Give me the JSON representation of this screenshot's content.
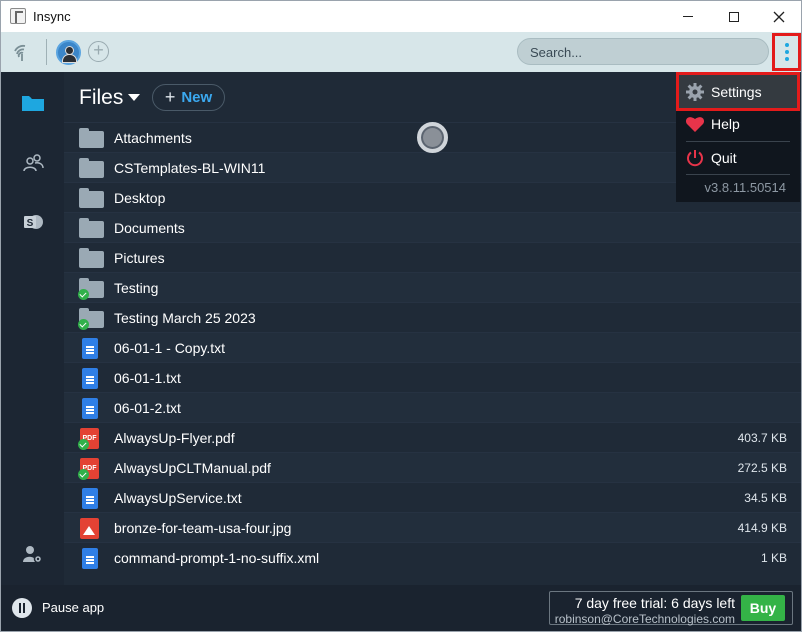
{
  "window": {
    "title": "Insync"
  },
  "toolbar": {
    "search_placeholder": "Search..."
  },
  "header": {
    "title": "Files",
    "new_label": "New"
  },
  "colors": {
    "accent": "#3ba9f0",
    "highlight": "#e31b1b",
    "buy": "#34b347"
  },
  "files": [
    {
      "name": "Attachments",
      "type": "folder",
      "synced": false,
      "size": ""
    },
    {
      "name": "CSTemplates-BL-WIN11",
      "type": "folder",
      "synced": false,
      "size": ""
    },
    {
      "name": "Desktop",
      "type": "folder",
      "synced": false,
      "size": ""
    },
    {
      "name": "Documents",
      "type": "folder",
      "synced": false,
      "size": ""
    },
    {
      "name": "Pictures",
      "type": "folder",
      "synced": false,
      "size": ""
    },
    {
      "name": "Testing",
      "type": "folder",
      "synced": true,
      "size": ""
    },
    {
      "name": "Testing March 25 2023",
      "type": "folder",
      "synced": true,
      "size": ""
    },
    {
      "name": "06-01-1 - Copy.txt",
      "type": "doc",
      "synced": false,
      "size": ""
    },
    {
      "name": "06-01-1.txt",
      "type": "doc",
      "synced": false,
      "size": ""
    },
    {
      "name": "06-01-2.txt",
      "type": "doc",
      "synced": false,
      "size": ""
    },
    {
      "name": "AlwaysUp-Flyer.pdf",
      "type": "pdf",
      "synced": true,
      "size": "403.7 KB"
    },
    {
      "name": "AlwaysUpCLTManual.pdf",
      "type": "pdf",
      "synced": true,
      "size": "272.5 KB"
    },
    {
      "name": "AlwaysUpService.txt",
      "type": "doc",
      "synced": false,
      "size": "34.5 KB"
    },
    {
      "name": "bronze-for-team-usa-four.jpg",
      "type": "image",
      "synced": false,
      "size": "414.9 KB"
    },
    {
      "name": "command-prompt-1-no-suffix.xml",
      "type": "doc",
      "synced": false,
      "size": "1 KB"
    }
  ],
  "menu": {
    "settings": "Settings",
    "help": "Help",
    "quit": "Quit",
    "version": "v3.8.11.50514"
  },
  "bottom": {
    "pause_label": "Pause app",
    "trial_text": "7 day free trial: 6 days left",
    "email": "robinson@CoreTechnologies.com",
    "buy_label": "Buy"
  }
}
